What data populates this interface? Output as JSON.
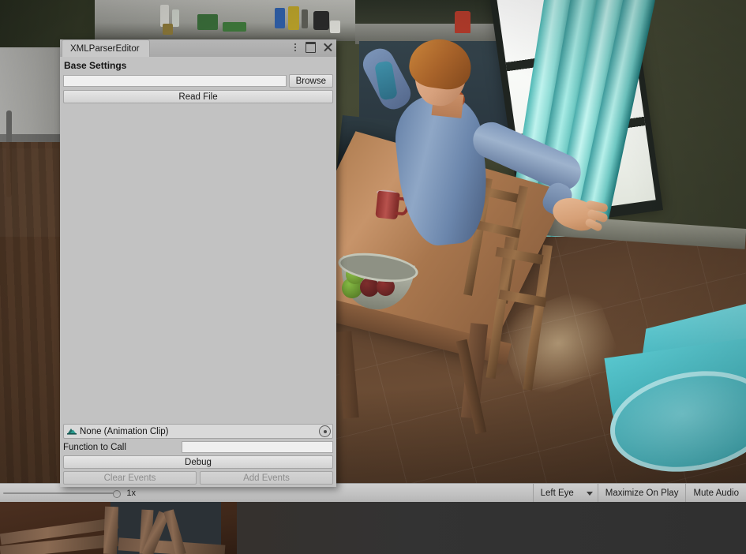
{
  "editor_window": {
    "tab_label": "XMLParserEditor",
    "titlebar": {
      "kebab_icon": "kebab-menu-icon",
      "maximize_icon": "maximize-icon",
      "close_icon": "close-icon"
    },
    "section_header": "Base Settings",
    "path_field": {
      "value": "",
      "placeholder": ""
    },
    "browse_button": "Browse",
    "read_file_button": "Read File",
    "object_field": {
      "icon": "animation-clip-icon",
      "label": "None (Animation Clip)",
      "picker_icon": "object-picker-icon"
    },
    "function_to_call": {
      "label": "Function to Call",
      "value": "",
      "placeholder": ""
    },
    "debug_button": "Debug",
    "clear_events_button": "Clear Events",
    "add_events_button": "Add Events"
  },
  "status_bar": {
    "zoom_label": "1x",
    "zoom_value": 1,
    "segments": [
      {
        "label": "Left Eye",
        "has_caret": true
      },
      {
        "label": "Maximize On Play",
        "has_caret": false
      },
      {
        "label": "Mute Audio",
        "has_caret": false
      }
    ]
  },
  "colors": {
    "panel_bg": "#c2c2c2",
    "titlebar": "#b6b6b6",
    "field_bg": "#efefef",
    "button_bg": "#dcdcdc",
    "disabled_text": "#8d8d8d",
    "status_bar_bg": "#c3c3c3",
    "curtain_cyan": "#7fdbe2",
    "character_shirt": "#8fa7c6",
    "table_wood": "#c7946a"
  }
}
